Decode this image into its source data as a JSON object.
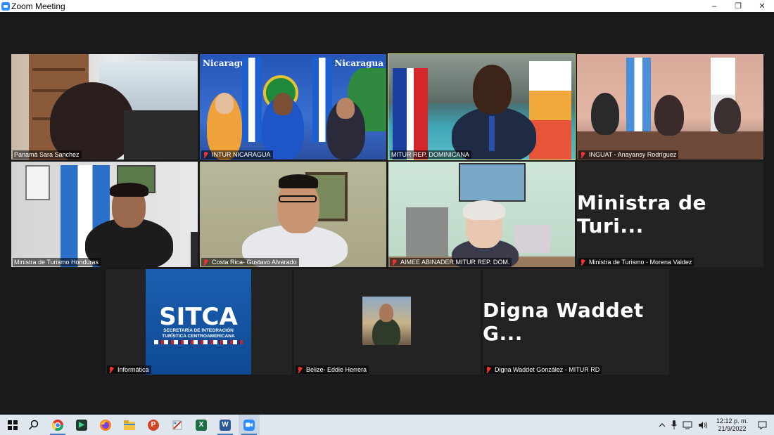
{
  "window": {
    "title": "Zoom Meeting",
    "minimize": "–",
    "restore": "❐",
    "close": "✕"
  },
  "tiles": [
    {
      "label": "Panamá Sara Sanchez",
      "muted": false
    },
    {
      "label": "INTUR NICARAGUA",
      "muted": true
    },
    {
      "label": "MITUR REP. DOMINICANA",
      "muted": false,
      "active": true
    },
    {
      "label": "INGUAT - Anayansy Rodríguez",
      "muted": true
    },
    {
      "label": "Ministra de Turismo Honduras",
      "muted": false
    },
    {
      "label": "Costa Rica- Gustavo Alvarado",
      "muted": true
    },
    {
      "label": "AIMEE ABINADER MITUR REP. DOM.",
      "muted": true
    },
    {
      "label": "Ministra de Turismo - Morena Valdez",
      "muted": true,
      "display_name": "Ministra de Turi..."
    },
    {
      "label": "Informática",
      "muted": true
    },
    {
      "label": "Belize- Eddie Herrera",
      "muted": true
    },
    {
      "label": "Digna Waddet González - MITUR RD",
      "muted": true,
      "display_name": "Digna Waddet G..."
    }
  ],
  "sitca": {
    "title": "SITCA",
    "subtitle_line1": "SECRETARÍA DE INTEGRACIÓN",
    "subtitle_line2": "TURÍSTICA CENTROAMERICANA"
  },
  "backgrounds": {
    "nicaragua_banner": "Nicaragua",
    "nicaragua_banner_right": "Nicaragua"
  },
  "taskbar": {
    "apps": [
      {
        "name": "start-icon"
      },
      {
        "name": "search-icon"
      },
      {
        "name": "chrome-icon"
      },
      {
        "name": "app-green-icon"
      },
      {
        "name": "firefox-icon"
      },
      {
        "name": "file-explorer-icon"
      },
      {
        "name": "powerpoint-icon"
      },
      {
        "name": "paint-icon"
      },
      {
        "name": "excel-icon"
      },
      {
        "name": "word-icon"
      },
      {
        "name": "zoom-icon"
      }
    ],
    "time": "12:12 p. m.",
    "date": "21/9/2022"
  },
  "colors": {
    "active_speaker": "#c8e07a",
    "muted_mic": "#ee3333",
    "zoom_blue": "#2d8cff"
  }
}
